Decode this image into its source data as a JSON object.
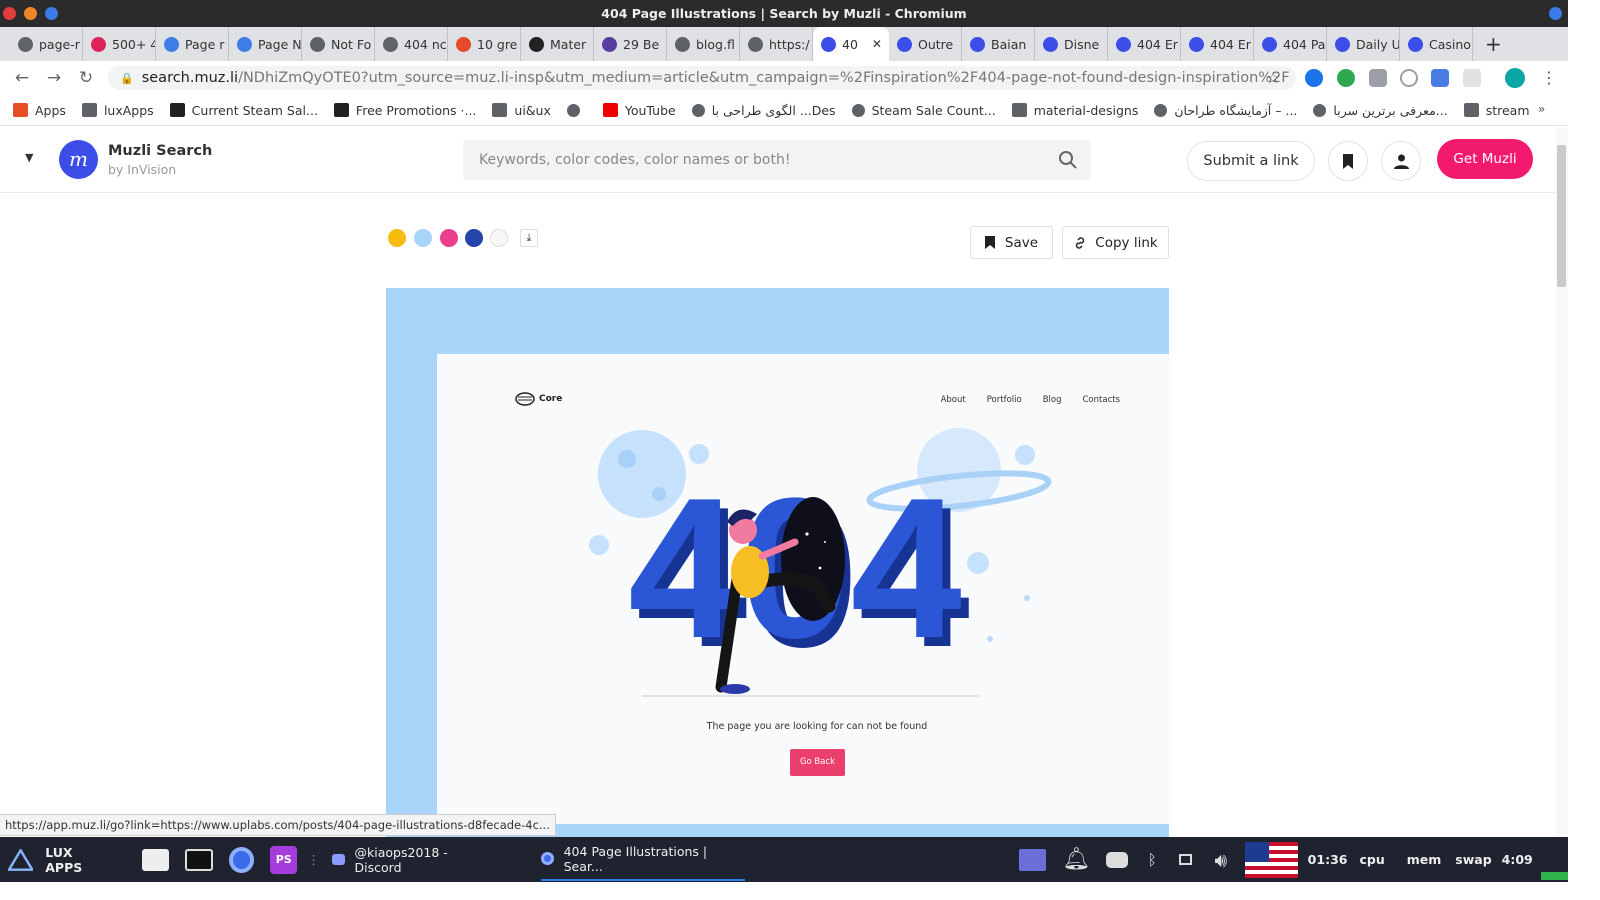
{
  "window": {
    "title": "404 Page Illustrations | Search by Muzli - Chromium"
  },
  "tabs": [
    {
      "label": "page-r",
      "color": "#5f6368"
    },
    {
      "label": "500+ 4",
      "color": "#e0235b"
    },
    {
      "label": "Page r",
      "color": "#3d7de8"
    },
    {
      "label": "Page N",
      "color": "#3d7de8"
    },
    {
      "label": "Not Fo",
      "color": "#5f6368"
    },
    {
      "label": "404 nc",
      "color": "#5f6368"
    },
    {
      "label": "10 gre",
      "color": "#e64a2b"
    },
    {
      "label": "Mater",
      "color": "#222222"
    },
    {
      "label": "29 Be",
      "color": "#5a3da0"
    },
    {
      "label": "blog.fl",
      "color": "#5f6368"
    },
    {
      "label": "https:/",
      "color": "#5f6368"
    },
    {
      "label": "40",
      "color": "#3d4ee8",
      "active": true
    },
    {
      "label": "Outre",
      "color": "#3d4ee8"
    },
    {
      "label": "Baian",
      "color": "#3d4ee8"
    },
    {
      "label": "Disne",
      "color": "#3d4ee8"
    },
    {
      "label": "404 Er",
      "color": "#3d4ee8"
    },
    {
      "label": "404 Er",
      "color": "#3d4ee8"
    },
    {
      "label": "404 Pa",
      "color": "#3d4ee8"
    },
    {
      "label": "Daily U",
      "color": "#3d4ee8"
    },
    {
      "label": "Casino",
      "color": "#3d4ee8"
    }
  ],
  "omnibox": {
    "host": "search.muz.li",
    "path": "/NDhiZmQyOTE0?utm_source=muz.li-insp&utm_medium=article&utm_campaign=%2Finspiration%2F404-page-not-found-design-inspiration%2F"
  },
  "bookmarks": [
    {
      "label": "Apps",
      "icon": "apps-grid-icon"
    },
    {
      "label": "luxApps",
      "icon": "folder-icon"
    },
    {
      "label": "Current Steam Sal...",
      "icon": "steam-icon"
    },
    {
      "label": "Free Promotions ·...",
      "icon": "steam-icon"
    },
    {
      "label": "ui&ux",
      "icon": "folder-icon"
    },
    {
      "label": "",
      "icon": "globe-icon"
    },
    {
      "label": "YouTube",
      "icon": "youtube-icon"
    },
    {
      "label": "الگوی طراحی با ...Des",
      "icon": "globe-icon"
    },
    {
      "label": "Steam Sale Count...",
      "icon": "globe-icon"
    },
    {
      "label": "material-designs",
      "icon": "folder-icon"
    },
    {
      "label": "آزمایشگاه طراحان – ...",
      "icon": "globe-icon"
    },
    {
      "label": "معرفی برترین سربا...",
      "icon": "globe-icon"
    },
    {
      "label": "stream",
      "icon": "folder-icon"
    }
  ],
  "header": {
    "logo_letter": "m",
    "brand": "Muzli Search",
    "brand_sub": "by InVision",
    "search_placeholder": "Keywords, color codes, color names or both!",
    "submit_label": "Submit a link",
    "get_label": "Get Muzli"
  },
  "palette": [
    "#f7bc0e",
    "#a9d5fb",
    "#ea3f8c",
    "#2344a8",
    "#f7f7f7"
  ],
  "actions": {
    "save_label": "Save",
    "copy_label": "Copy link"
  },
  "preview": {
    "logo_text": "Core",
    "nav": [
      "About",
      "Portfolio",
      "Blog",
      "Contacts"
    ],
    "headline": "404",
    "message": "The page you are looking for can not be found",
    "button": "Go Back"
  },
  "status_url": "https://app.muz.li/go?link=https://www.uplabs.com/posts/404-page-illustrations-d8fecade-4c...",
  "taskbar": {
    "launcher": "LUX APPS",
    "windows": [
      "@kiaops2018 - Discord",
      "404 Page Illustrations | Sear..."
    ],
    "time": "01:36",
    "cpu": "cpu",
    "mem": "mem",
    "swap": "swap",
    "clock2": "4:09"
  }
}
